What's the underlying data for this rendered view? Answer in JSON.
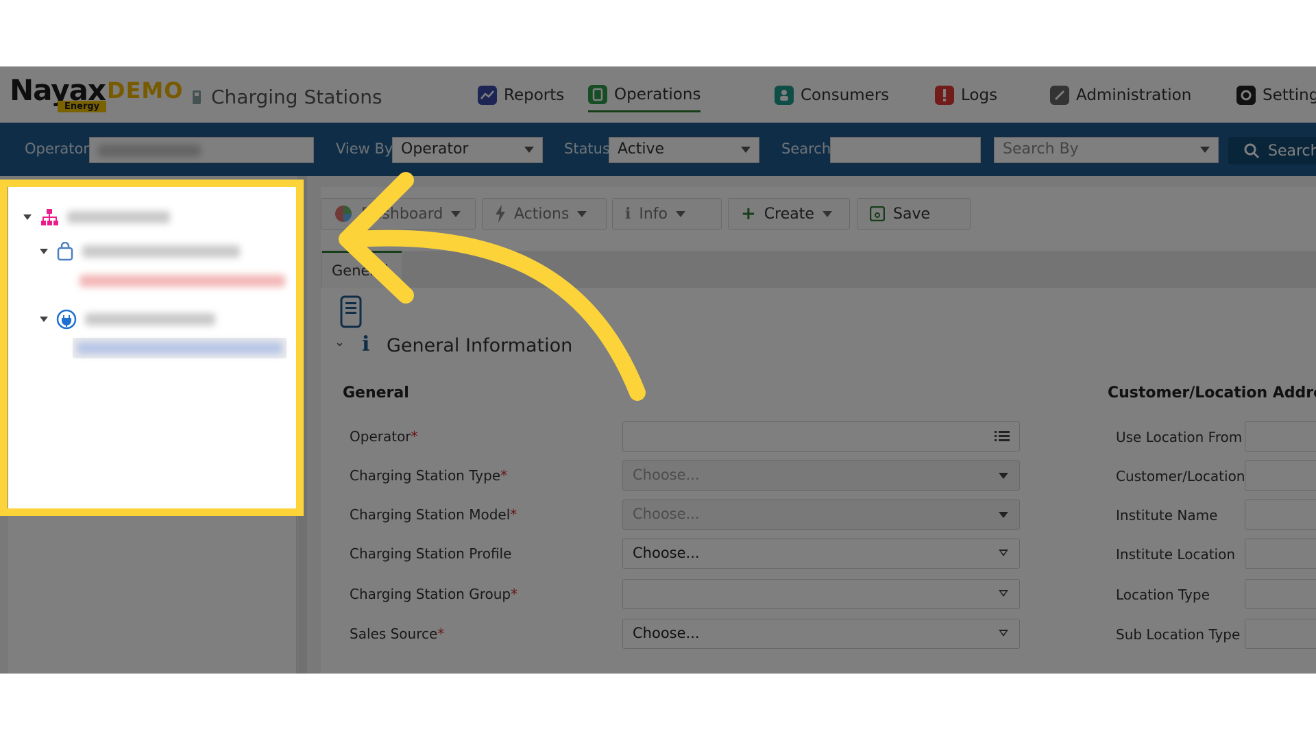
{
  "header": {
    "brand": "Nayax",
    "demo": "DEMO",
    "energy": "Energy",
    "app_title": "Charging Stations",
    "nav": [
      {
        "label": "Reports",
        "icon": "reports-chart-icon",
        "color": "#3b4ba8"
      },
      {
        "label": "Operations",
        "icon": "operations-icon",
        "color": "#2e9a4a"
      },
      {
        "label": "Consumers",
        "icon": "consumers-icon",
        "color": "#1f9a8f"
      },
      {
        "label": "Logs",
        "icon": "logs-alert-icon",
        "color": "#e53935"
      },
      {
        "label": "Administration",
        "icon": "administration-icon",
        "color": "#666666"
      },
      {
        "label": "Settings",
        "icon": "settings-gear-icon",
        "color": "#222222"
      }
    ]
  },
  "filters": {
    "operator_label": "Operator",
    "view_by_label": "View By",
    "view_by_value": "Operator",
    "status_label": "Status",
    "status_value": "Active",
    "search_label": "Search",
    "search_by_placeholder": "Search By",
    "search_button": "Search"
  },
  "toolbar": {
    "dashboard": "Dashboard",
    "actions": "Actions",
    "info": "Info",
    "create": "Create",
    "save": "Save"
  },
  "tabs": {
    "general": "General"
  },
  "section": {
    "general_information": "General Information"
  },
  "general": {
    "title": "General",
    "fields": [
      {
        "label": "Operator",
        "required": "*",
        "value": "",
        "kind": "list",
        "disabled": false
      },
      {
        "label": "Charging Station Type",
        "required": "*",
        "value": "Choose...",
        "kind": "dropdown",
        "disabled": true
      },
      {
        "label": "Charging Station Model",
        "required": "*",
        "value": "Choose...",
        "kind": "dropdown",
        "disabled": true
      },
      {
        "label": "Charging Station Profile",
        "required": "",
        "value": "Choose...",
        "kind": "select",
        "disabled": false
      },
      {
        "label": "Charging Station Group",
        "required": "*",
        "value": "",
        "kind": "select",
        "disabled": false
      },
      {
        "label": "Sales Source",
        "required": "*",
        "value": "Choose...",
        "kind": "select",
        "disabled": false
      }
    ]
  },
  "customer_location": {
    "title": "Customer/Location Address",
    "fields": [
      "Use Location From",
      "Customer/Location",
      "Institute Name",
      "Institute Location",
      "Location Type",
      "Sub Location Type"
    ]
  },
  "colors": {
    "header_bar": "#1e5b8e",
    "highlight": "#fcd43a",
    "active_tab": "#2e7d32",
    "required": "#d32f2f"
  }
}
